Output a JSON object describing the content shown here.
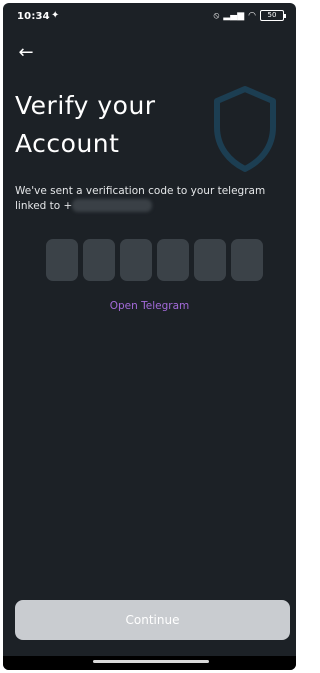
{
  "status_bar": {
    "time": "10:34",
    "battery": "50",
    "icons": [
      "notification-icon",
      "mute-icon",
      "signal-icon",
      "wifi-icon",
      "battery-icon"
    ]
  },
  "header": {
    "back_icon": "arrow-left-icon",
    "title_line1": "Verify your",
    "title_line2": "Account",
    "decoration_icon": "shield-icon"
  },
  "message": {
    "line1": "We've sent a verification code to your telegram",
    "line2_prefix": "linked to +"
  },
  "otp": {
    "box_count": 6,
    "boxes": [
      "",
      "",
      "",
      "",
      "",
      ""
    ]
  },
  "open_telegram_label": "Open Telegram",
  "continue_label": "Continue",
  "colors": {
    "background": "#1c2126",
    "otp_box": "#3b4248",
    "link": "#a36ad9",
    "button_disabled": "#c9ccd0",
    "shield_outline": "#1c3e52"
  }
}
